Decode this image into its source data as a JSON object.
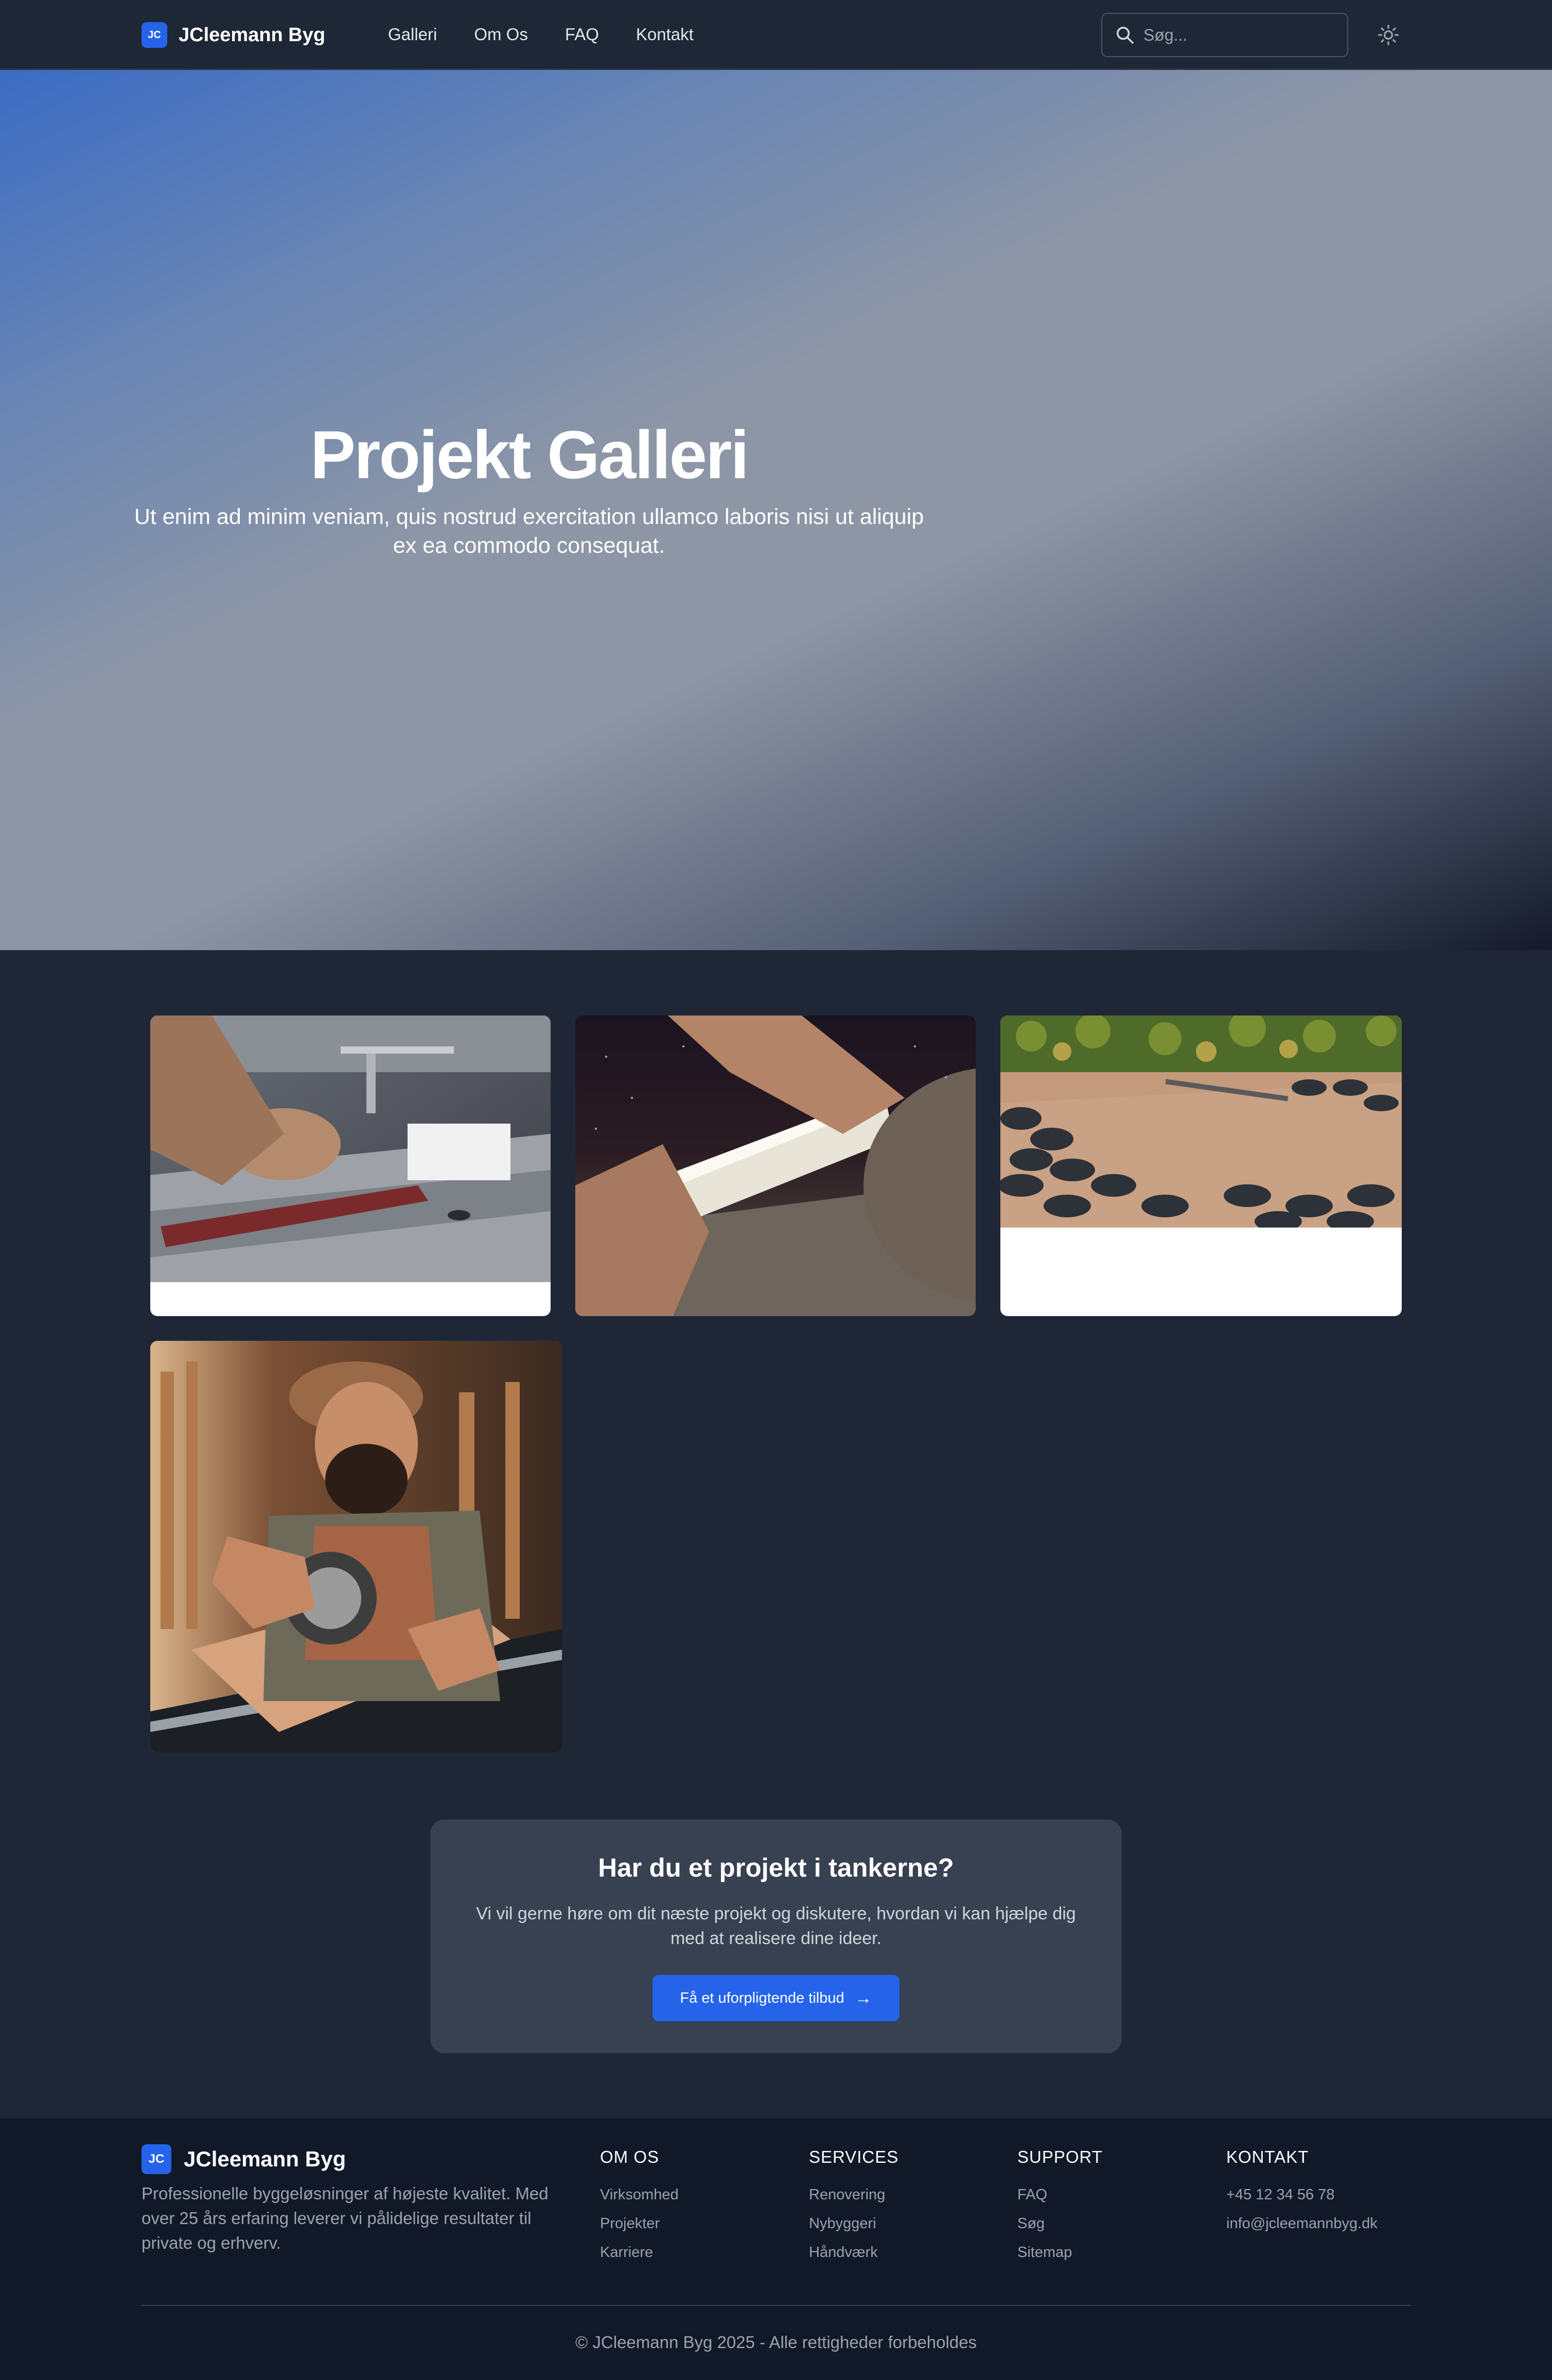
{
  "nav": {
    "brand_badge": "JC",
    "brand_name": "JCleemann Byg",
    "links": [
      "Galleri",
      "Om Os",
      "FAQ",
      "Kontakt"
    ],
    "search_placeholder": "Søg...",
    "theme_icon": "sun-icon"
  },
  "hero": {
    "title": "Projekt Galleri",
    "subtitle": "Ut enim ad minim veniam, quis nostrud exercitation ullamco laboris nisi ut aliquip ex ea commodo consequat."
  },
  "gallery": {
    "images": [
      "table-saw-hands-photo",
      "wood-cutting-saw-photo",
      "roof-shingles-photo",
      "carpenter-circular-saw-photo"
    ]
  },
  "cta": {
    "title": "Har du et projekt i tankerne?",
    "text": "Vi vil gerne høre om dit næste projekt og diskutere, hvordan vi kan hjælpe dig med at realisere dine ideer.",
    "button_label": "Få et uforpligtende tilbud",
    "button_icon": "arrow-right-icon"
  },
  "footer": {
    "brand_badge": "JC",
    "brand_name": "JCleemann Byg",
    "description": "Professionelle byggeløsninger af højeste kvalitet. Med over 25 års erfaring leverer vi pålidelige resultater til private og erhverv.",
    "columns": [
      {
        "title": "OM OS",
        "items": [
          "Virksomhed",
          "Projekter",
          "Karriere"
        ]
      },
      {
        "title": "SERVICES",
        "items": [
          "Renovering",
          "Nybyggeri",
          "Håndværk"
        ]
      },
      {
        "title": "SUPPORT",
        "items": [
          "FAQ",
          "Søg",
          "Sitemap"
        ]
      },
      {
        "title": "KONTAKT",
        "items": [
          "+45 12 34 56 78",
          "info@jcleemannbyg.dk"
        ]
      }
    ],
    "copyright": "© JCleemann Byg 2025 - Alle rettigheder forbeholdes"
  },
  "colors": {
    "accent": "#2563eb",
    "page_bg": "#1f2737",
    "footer_bg": "#111827",
    "cta_bg": "#374151"
  }
}
